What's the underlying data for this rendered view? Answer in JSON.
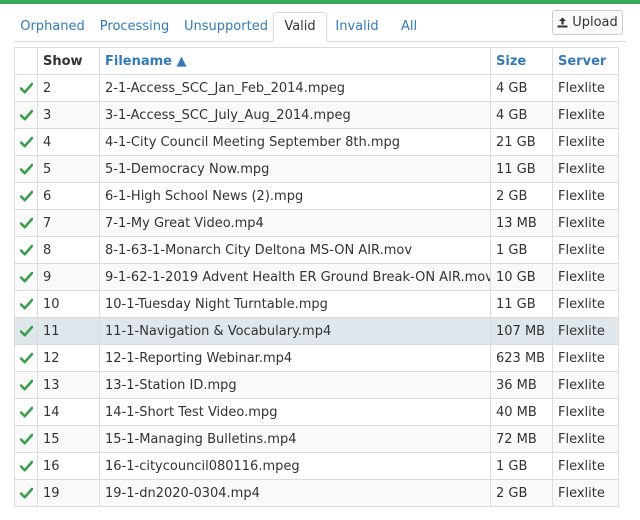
{
  "colors": {
    "accent_green": "#3aa757",
    "link_blue": "#337ab7",
    "check_green": "#3b9e4f",
    "row_highlight": "#dfe6ec"
  },
  "tabs": [
    {
      "label": "Orphaned",
      "active": false
    },
    {
      "label": "Processing",
      "active": false
    },
    {
      "label": "Unsupported",
      "active": false
    },
    {
      "label": "Valid",
      "active": true
    },
    {
      "label": "Invalid",
      "active": false
    },
    {
      "label": "All",
      "active": false
    }
  ],
  "upload": {
    "label": "Upload",
    "icon": "upload-icon"
  },
  "table": {
    "columns": {
      "status": "",
      "show": "Show",
      "filename": "Filename ▲",
      "size": "Size",
      "server": "Server"
    },
    "sort": {
      "column": "filename",
      "direction": "ascending"
    },
    "rows": [
      {
        "status": "valid",
        "show": "2",
        "filename": "2-1-Access_SCC_Jan_Feb_2014.mpeg",
        "size": "4 GB",
        "server": "Flexlite"
      },
      {
        "status": "valid",
        "show": "3",
        "filename": "3-1-Access_SCC_July_Aug_2014.mpeg",
        "size": "4 GB",
        "server": "Flexlite"
      },
      {
        "status": "valid",
        "show": "4",
        "filename": "4-1-City Council Meeting September 8th.mpg",
        "size": "21 GB",
        "server": "Flexlite"
      },
      {
        "status": "valid",
        "show": "5",
        "filename": "5-1-Democracy Now.mpg",
        "size": "11 GB",
        "server": "Flexlite"
      },
      {
        "status": "valid",
        "show": "6",
        "filename": "6-1-High School News (2).mpg",
        "size": "2 GB",
        "server": "Flexlite"
      },
      {
        "status": "valid",
        "show": "7",
        "filename": "7-1-My Great Video.mp4",
        "size": "13 MB",
        "server": "Flexlite"
      },
      {
        "status": "valid",
        "show": "8",
        "filename": "8-1-63-1-Monarch City Deltona MS-ON AIR.mov",
        "size": "1 GB",
        "server": "Flexlite"
      },
      {
        "status": "valid",
        "show": "9",
        "filename": "9-1-62-1-2019 Advent Health ER Ground Break-ON AIR.mov",
        "size": "10 GB",
        "server": "Flexlite"
      },
      {
        "status": "valid",
        "show": "10",
        "filename": "10-1-Tuesday Night Turntable.mpg",
        "size": "11 GB",
        "server": "Flexlite"
      },
      {
        "status": "valid",
        "show": "11",
        "filename": "11-1-Navigation & Vocabulary.mp4",
        "size": "107 MB",
        "server": "Flexlite",
        "highlighted": true
      },
      {
        "status": "valid",
        "show": "12",
        "filename": "12-1-Reporting Webinar.mp4",
        "size": "623 MB",
        "server": "Flexlite"
      },
      {
        "status": "valid",
        "show": "13",
        "filename": "13-1-Station ID.mpg",
        "size": "36 MB",
        "server": "Flexlite"
      },
      {
        "status": "valid",
        "show": "14",
        "filename": "14-1-Short Test Video.mpg",
        "size": "40 MB",
        "server": "Flexlite"
      },
      {
        "status": "valid",
        "show": "15",
        "filename": "15-1-Managing Bulletins.mp4",
        "size": "72 MB",
        "server": "Flexlite"
      },
      {
        "status": "valid",
        "show": "16",
        "filename": "16-1-citycouncil080116.mpeg",
        "size": "1 GB",
        "server": "Flexlite"
      },
      {
        "status": "valid",
        "show": "19",
        "filename": "19-1-dn2020-0304.mp4",
        "size": "2 GB",
        "server": "Flexlite"
      }
    ]
  }
}
